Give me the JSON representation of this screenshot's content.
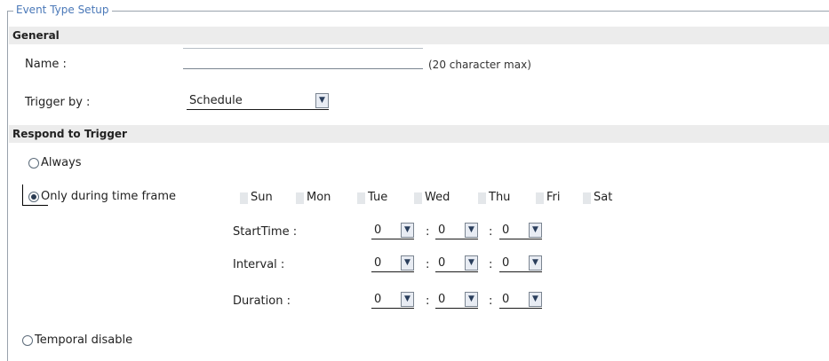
{
  "legend": "Event Type Setup",
  "general": {
    "header": "General",
    "name_label": "Name :",
    "name_value": "",
    "name_hint": "(20 character max)",
    "trigger_label": "Trigger by :",
    "trigger_value": "Schedule"
  },
  "respond": {
    "header": "Respond to Trigger",
    "always_label": "Always",
    "timeframe_label": "Only during time frame",
    "days": [
      "Sun",
      "Mon",
      "Tue",
      "Wed",
      "Thu",
      "Fri",
      "Sat"
    ],
    "start_label": "StartTime :",
    "interval_label": "Interval :",
    "duration_label": "Duration :",
    "start": [
      "0",
      "0",
      "0"
    ],
    "interval": [
      "0",
      "0",
      "0"
    ],
    "duration": [
      "0",
      "0",
      "0"
    ],
    "temporal_label": "Temporal disable",
    "selected": "timeframe"
  }
}
